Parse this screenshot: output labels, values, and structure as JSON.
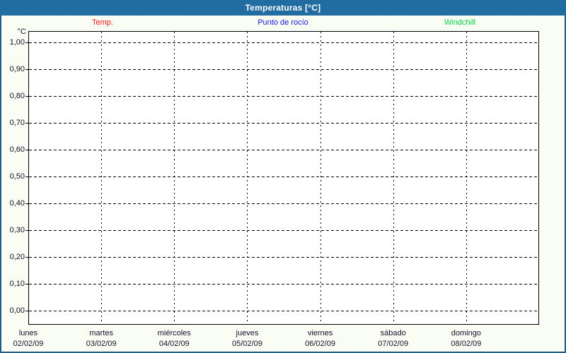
{
  "header": {
    "title": "Temperaturas [°C]"
  },
  "colors": {
    "header_bg": "#1F6BA0",
    "window_border": "#1D5F8A",
    "content_bg": "#FAFDF4",
    "plot_bg": "#FFFFFF",
    "grid": "#000000",
    "tick_text": "#10102A"
  },
  "chart_data": {
    "type": "line",
    "title": "Temperaturas [°C]",
    "y_unit": "°C",
    "xlabel": "",
    "ylabel": "",
    "ylim": [
      0.0,
      1.0
    ],
    "ytick_step": 0.1,
    "ytick_labels": [
      "1,00",
      "0,90",
      "0,80",
      "0,70",
      "0,60",
      "0,50",
      "0,40",
      "0,30",
      "0,20",
      "0,10",
      "0,00"
    ],
    "x_categories": [
      {
        "day": "lunes",
        "date": "02/02/09"
      },
      {
        "day": "martes",
        "date": "03/02/09"
      },
      {
        "day": "miércoles",
        "date": "04/02/09"
      },
      {
        "day": "jueves",
        "date": "05/02/09"
      },
      {
        "day": "viernes",
        "date": "06/02/09"
      },
      {
        "day": "sábado",
        "date": "07/02/09"
      },
      {
        "day": "domingo",
        "date": "08/02/09"
      }
    ],
    "grid": "dashed",
    "legend_position": "top",
    "series": [
      {
        "name": "Temp.",
        "color": "#F01414",
        "values": []
      },
      {
        "name": "Punto de rocío",
        "color": "#1414E0",
        "values": []
      },
      {
        "name": "Windchill",
        "color": "#00CC44",
        "values": []
      }
    ]
  }
}
